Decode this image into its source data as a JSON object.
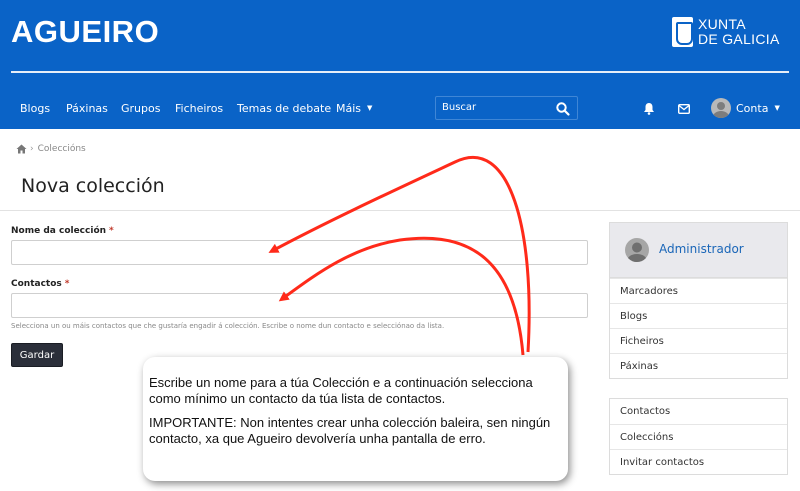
{
  "header": {
    "brand": "AGUEIRO",
    "logo_line1": "XUNTA",
    "logo_line2": "DE GALICIA",
    "nav": [
      "Blogs",
      "Páxinas",
      "Grupos",
      "Ficheiros",
      "Temas de debate",
      "Máis"
    ],
    "search_placeholder": "Buscar",
    "account_label": "Conta",
    "icons": [
      "search-icon",
      "bell-icon",
      "mail-icon",
      "avatar",
      "chevron-down-icon"
    ],
    "color": "#0a63c7"
  },
  "breadcrumb": {
    "item": "Coleccións"
  },
  "page": {
    "title": "Nova colección"
  },
  "form": {
    "name_label": "Nome da colección",
    "contacts_label": "Contactos",
    "required_mark": "*",
    "help_text": "Selecciona un ou máis contactos que che gustaría engadir á colección. Escribe o nome dun contacto e selecciónao da lista.",
    "save_label": "Gardar"
  },
  "sidebar": {
    "user_name": "Administrador",
    "menu1": [
      "Marcadores",
      "Blogs",
      "Ficheiros",
      "Páxinas"
    ],
    "menu2": [
      "Contactos",
      "Coleccións",
      "Invitar contactos"
    ]
  },
  "callout": {
    "line1": "Escribe un nome para a túa Colección e a continuación selecciona como mínimo un contacto da túa lista de contactos.",
    "line2": "IMPORTANTE: Non intentes crear unha colección baleira, sen ningún contacto, xa que Agueiro devolvería unha pantalla de erro."
  },
  "colors": {
    "arrow": "#ff2a1a",
    "accent": "#1a66b8"
  }
}
